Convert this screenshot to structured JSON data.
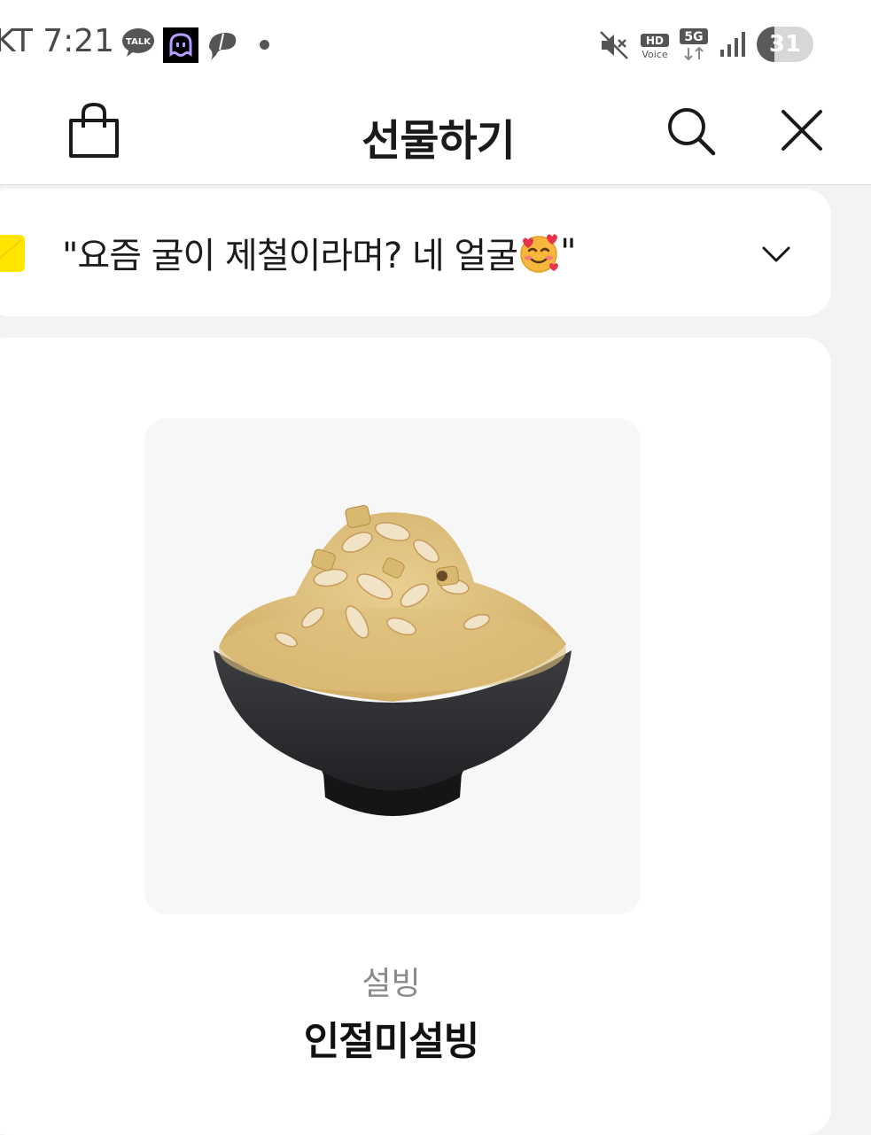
{
  "status_bar": {
    "carrier_time": "KT 7:21",
    "talk_badge": "TALK",
    "hd_label": "HD",
    "voice_label": "Voice",
    "network_label": "5G",
    "battery_level": "31",
    "battery_fraction": 0.31
  },
  "header": {
    "title": "선물하기"
  },
  "message": {
    "text": "\"요즘 굴이 제철이라며? 네 얼굴",
    "text_end": "\""
  },
  "product": {
    "category": "설빙",
    "name": "인절미설빙"
  },
  "colors": {
    "envelope": "#ffe500",
    "background": "#f3f3f3",
    "card": "#ffffff"
  }
}
